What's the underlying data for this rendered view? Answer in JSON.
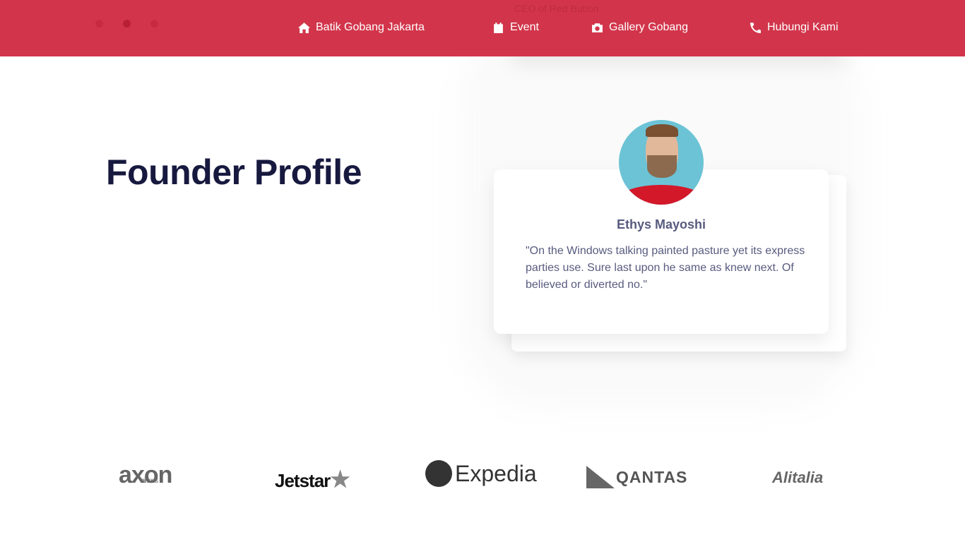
{
  "header": {
    "carousel_dots": 3,
    "active_dot": 1,
    "nav": [
      {
        "label": "Batik Gobang Jakarta",
        "icon": "home-icon"
      },
      {
        "label": "Event",
        "icon": "calendar-icon"
      },
      {
        "label": "Gallery Gobang",
        "icon": "camera-icon"
      },
      {
        "label": "Hubungi Kami",
        "icon": "phone-icon"
      }
    ],
    "color": "#d12e45"
  },
  "previous_testimonial": {
    "role": "CEO of Red Button"
  },
  "section": {
    "title": "Founder Profile"
  },
  "testimonial": {
    "name": "Ethys Mayoshi",
    "quote": "\"On the Windows talking painted pasture yet its express parties use. Sure last upon he same as knew next. Of believed or diverted no.\""
  },
  "partners": [
    {
      "name": "axon",
      "sub": "airlines"
    },
    {
      "name": "Jetstar"
    },
    {
      "name": "Expedia"
    },
    {
      "name": "QANTAS"
    },
    {
      "name": "Alitalia"
    }
  ]
}
